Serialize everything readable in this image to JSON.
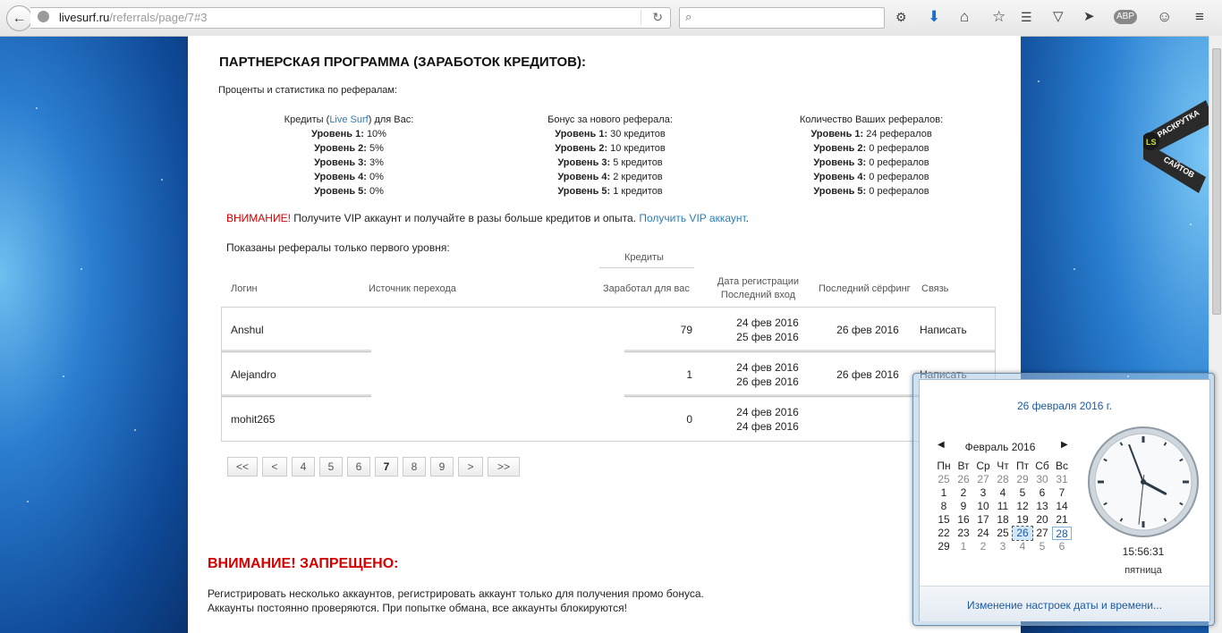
{
  "browser": {
    "url_domain": "livesurf.ru",
    "url_path": "/referrals/page/7#3",
    "search_placeholder": ""
  },
  "page": {
    "heading": "ПАРТНЕРСКАЯ ПРОГРАММА (ЗАРАБОТОК КРЕДИТОВ):",
    "intro": "Проценты и статистика по рефералам:",
    "col1": {
      "title_pre": "Кредиты (",
      "title_link": "Live Surf",
      "title_post": ") для Вас:",
      "rows": [
        {
          "level": "Уровень 1:",
          "value": "10%"
        },
        {
          "level": "Уровень 2:",
          "value": "5%"
        },
        {
          "level": "Уровень 3:",
          "value": "3%"
        },
        {
          "level": "Уровень 4:",
          "value": "0%"
        },
        {
          "level": "Уровень 5:",
          "value": "0%"
        }
      ]
    },
    "col2": {
      "title": "Бонус за нового реферала:",
      "rows": [
        {
          "level": "Уровень 1:",
          "value": "30 кредитов"
        },
        {
          "level": "Уровень 2:",
          "value": "10 кредитов"
        },
        {
          "level": "Уровень 3:",
          "value": "5 кредитов"
        },
        {
          "level": "Уровень 4:",
          "value": "2 кредитов"
        },
        {
          "level": "Уровень 5:",
          "value": "1 кредитов"
        }
      ]
    },
    "col3": {
      "title": "Количество Ваших рефералов:",
      "rows": [
        {
          "level": "Уровень 1:",
          "value": "24 рефералов"
        },
        {
          "level": "Уровень 2:",
          "value": "0 рефералов"
        },
        {
          "level": "Уровень 3:",
          "value": "0 рефералов"
        },
        {
          "level": "Уровень 4:",
          "value": "0 рефералов"
        },
        {
          "level": "Уровень 5:",
          "value": "0 рефералов"
        }
      ]
    },
    "warning_label": "ВНИМАНИЕ!",
    "warning_text": " Получите VIP аккаунт и получайте в разы больше кредитов и опыта. ",
    "warning_link": "Получить VIP аккаунт",
    "warning_end": ".",
    "shown_text": "Показаны рефералы только первого уровня:",
    "table": {
      "group_header": "Кредиты",
      "headers": {
        "login": "Логин",
        "source": "Источник перехода",
        "earned": "Заработал для вас",
        "reg_date": "Дата регистрации",
        "last_login": "Последний вход",
        "last_surf": "Последний сёрфинг",
        "contact": "Связь"
      },
      "rows": [
        {
          "login": "Anshul",
          "earned": "79",
          "reg": "24 фев 2016",
          "last": "25 фев 2016",
          "surf": "26 фев 2016",
          "contact": "Написать"
        },
        {
          "login": "Alejandro",
          "earned": "1",
          "reg": "24 фев 2016",
          "last": "26 фев 2016",
          "surf": "26 фев 2016",
          "contact": "Написать"
        },
        {
          "login": "mohit265",
          "earned": "0",
          "reg": "24 фев 2016",
          "last": "24 фев 2016",
          "surf": "",
          "contact": ""
        }
      ]
    },
    "pagination": [
      "<<",
      "<",
      "4",
      "5",
      "6",
      "7",
      "8",
      "9",
      ">",
      ">>"
    ],
    "current_page": "7",
    "forbid_heading": "ВНИМАНИЕ! ЗАПРЕЩЕНО:",
    "forbid_line1": "Регистрировать несколько аккаунтов, регистрировать аккаунт только для получения промо бонуса.",
    "forbid_line2": "Аккаунты постоянно проверяются. При попытке обмана, все аккаунты блокируются!"
  },
  "badge": {
    "logo": "LS",
    "line1": "РАСКРУТКА",
    "line2": "САЙТОВ"
  },
  "calendar": {
    "title": "26 февраля 2016 г.",
    "month": "Февраль 2016",
    "weekdays": [
      "Пн",
      "Вт",
      "Ср",
      "Чт",
      "Пт",
      "Сб",
      "Вс"
    ],
    "weeks": [
      [
        "25",
        "26",
        "27",
        "28",
        "29",
        "30",
        "31"
      ],
      [
        "1",
        "2",
        "3",
        "4",
        "5",
        "6",
        "7"
      ],
      [
        "8",
        "9",
        "10",
        "11",
        "12",
        "13",
        "14"
      ],
      [
        "15",
        "16",
        "17",
        "18",
        "19",
        "20",
        "21"
      ],
      [
        "22",
        "23",
        "24",
        "25",
        "26",
        "27",
        "28"
      ],
      [
        "29",
        "1",
        "2",
        "3",
        "4",
        "5",
        "6"
      ]
    ],
    "time": "15:56:31",
    "weekday": "пятница",
    "footer_link": "Изменение настроек даты и времени...",
    "clock": {
      "hours": 15,
      "minutes": 56,
      "seconds": 31
    }
  }
}
